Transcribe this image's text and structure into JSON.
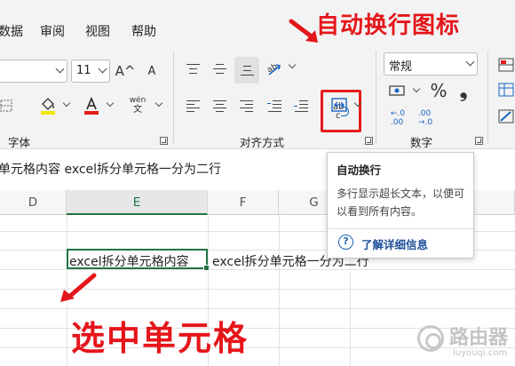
{
  "menu": {
    "items": [
      "数据",
      "审阅",
      "视图",
      "帮助"
    ]
  },
  "ribbon": {
    "font_size": "11",
    "grow_font": "A^",
    "shrink_font": "A",
    "phonetic_top": "wén",
    "phonetic_bottom": "文",
    "groups": {
      "font": "字体",
      "alignment": "对齐方式",
      "number": "数字"
    },
    "number_format": "常规",
    "percent": "%",
    "comma": "❟",
    "inc_decimal": "←.0\n.00",
    "dec_decimal": ".00\n→.0",
    "wrap_icon_top": "ab",
    "wrap_icon_bottom": "c",
    "wrap_color": "#e51c1c"
  },
  "formula_bar": {
    "content": "单元格内容 excel拆分单元格一分为二行"
  },
  "grid": {
    "columns": [
      "D",
      "E",
      "F",
      "G"
    ],
    "selected_column": "E",
    "cell_value": "excel拆分单元格内容",
    "overflow_text": "excel拆分单元格一分为二行"
  },
  "tooltip": {
    "title": "自动换行",
    "description": "多行显示超长文本，以便可以看到所有内容。",
    "help_icon": "?",
    "link": "了解详细信息"
  },
  "annotations": {
    "top": "自动换行图标",
    "bottom": "选中单元格",
    "color": "#e5161b"
  },
  "watermark": {
    "name": "路由器",
    "domain": "luyouqi.com"
  }
}
